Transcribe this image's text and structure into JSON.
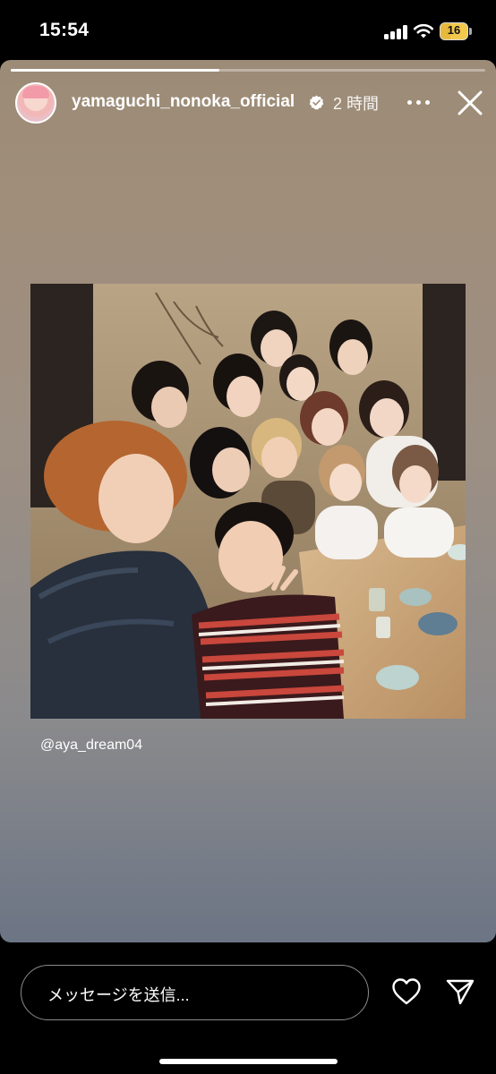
{
  "status_bar": {
    "time": "15:54",
    "battery_level": "16",
    "battery_color": "#f2c94c"
  },
  "story": {
    "progress_fraction": 0.44,
    "username": "yamaguchi_nonoka_official",
    "verified": true,
    "time_ago": "2 時間",
    "more_icon": "more-horizontal-icon",
    "close_icon": "close-icon",
    "photo_caption": "@aya_dream04"
  },
  "reply_bar": {
    "message_placeholder": "メッセージを送信...",
    "like_icon": "heart-icon",
    "send_icon": "paper-plane-icon"
  }
}
